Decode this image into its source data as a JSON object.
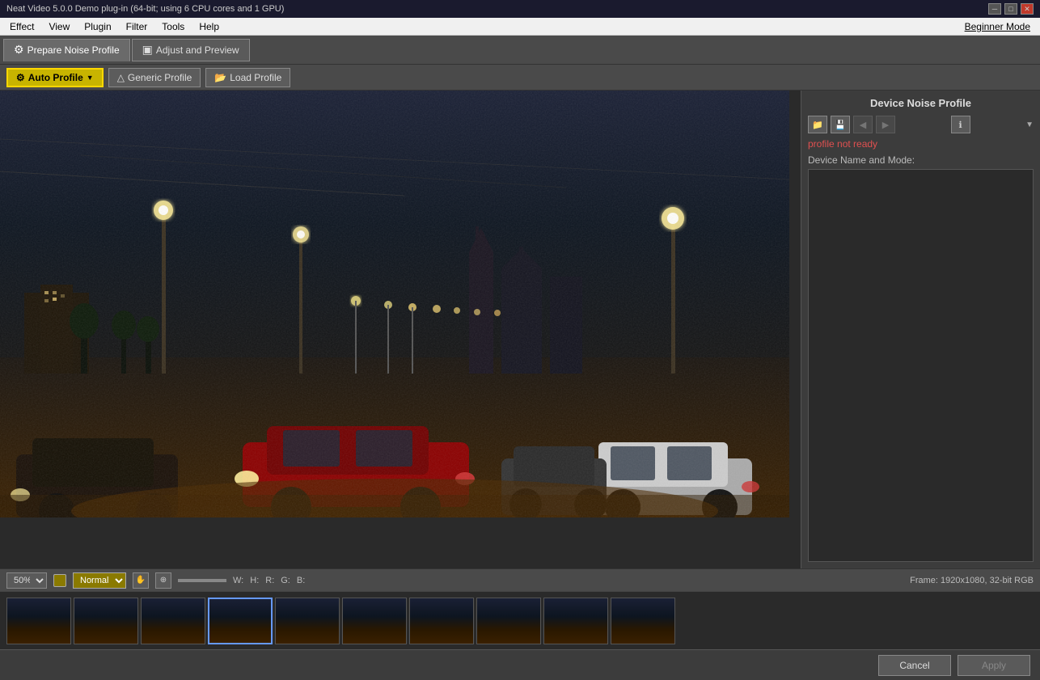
{
  "titlebar": {
    "title": "Neat Video 5.0.0  Demo plug-in (64-bit; using 6 CPU cores and 1 GPU)",
    "controls": [
      "minimize",
      "maximize",
      "close"
    ]
  },
  "menubar": {
    "items": [
      "Effect",
      "View",
      "Plugin",
      "Filter",
      "Tools",
      "Help"
    ],
    "beginner_mode": "Beginner Mode"
  },
  "toolbar": {
    "tabs": [
      {
        "label": "Prepare Noise Profile",
        "active": true
      },
      {
        "label": "Adjust and Preview",
        "active": false
      }
    ]
  },
  "profile_bar": {
    "buttons": [
      {
        "label": "Auto Profile",
        "active": true
      },
      {
        "label": "Generic Profile",
        "active": false
      },
      {
        "label": "Load Profile",
        "active": false
      }
    ]
  },
  "right_panel": {
    "title": "Device Noise Profile",
    "status": "profile not ready",
    "device_name_label": "Device Name and Mode:"
  },
  "status_bar": {
    "zoom": "50%",
    "mode": "Normal",
    "labels": {
      "w": "W:",
      "h": "H:",
      "r": "R:",
      "g": "G:",
      "b": "B:"
    },
    "frame_info": "Frame: 1920x1080, 32-bit RGB"
  },
  "filmstrip": {
    "thumbs": [
      1,
      2,
      3,
      4,
      5,
      6,
      7,
      8,
      9,
      10
    ],
    "selected": 4
  },
  "bottom_bar": {
    "cancel_label": "Cancel",
    "apply_label": "Apply"
  }
}
